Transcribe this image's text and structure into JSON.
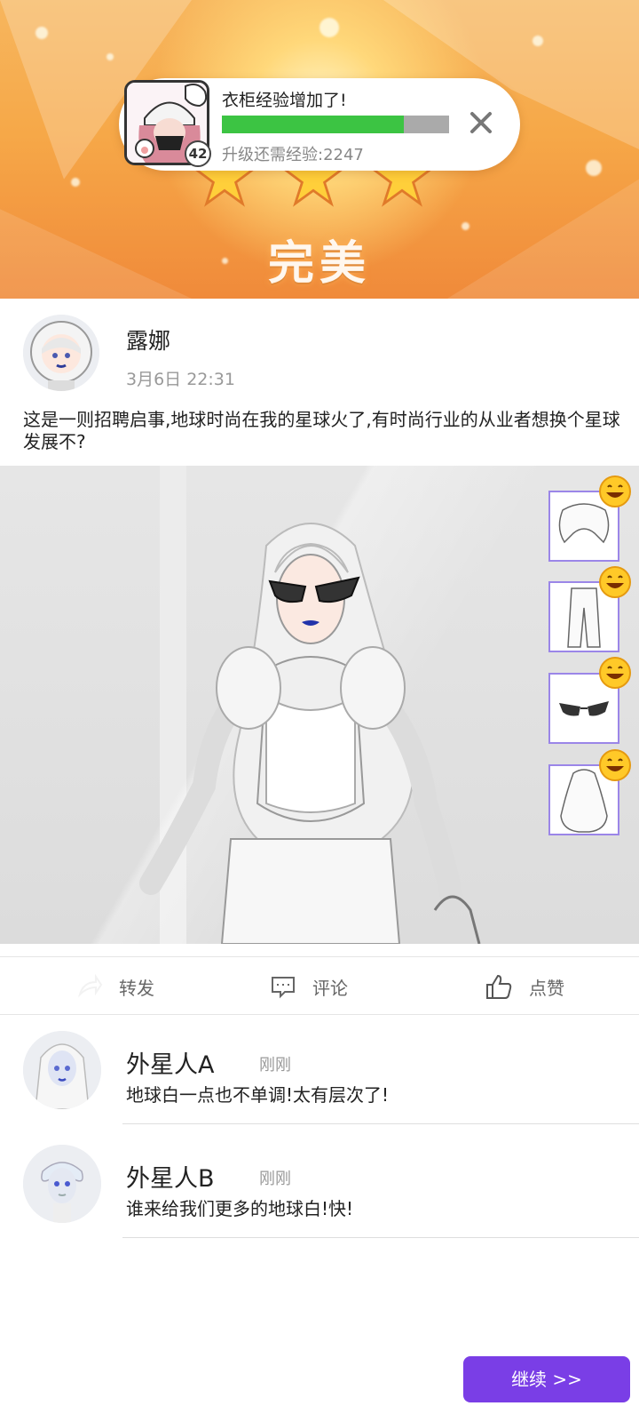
{
  "toast": {
    "title": "衣柜经验增加了!",
    "progress": 0.8,
    "need_label": "升级还需经验:2247",
    "level": "42",
    "bar_fill_color": "#3cc443",
    "bar_track_color": "#aaaaaa",
    "close_icon": "close-icon"
  },
  "result": {
    "stars": 3,
    "rating": "完美"
  },
  "post": {
    "author": "露娜",
    "time": "3月6日 22:31",
    "text": "这是一则招聘启事,地球时尚在我的星球火了,有时尚行业的从业者想换个星球发展不?"
  },
  "outfit_items": [
    {
      "icon": "cape-item-icon",
      "reaction": "smiley-icon"
    },
    {
      "icon": "pants-item-icon",
      "reaction": "smiley-icon"
    },
    {
      "icon": "sunglasses-item-icon",
      "reaction": "smiley-icon"
    },
    {
      "icon": "hair-item-icon",
      "reaction": "smiley-icon"
    }
  ],
  "actions": {
    "share": "转发",
    "comment": "评论",
    "like": "点赞"
  },
  "comments": [
    {
      "name": "外星人A",
      "time": "刚刚",
      "text": "地球白一点也不单调!太有层次了!"
    },
    {
      "name": "外星人B",
      "time": "刚刚",
      "text": "谁来给我们更多的地球白!快!"
    }
  ],
  "continue_label": "继续 >>",
  "colors": {
    "accent": "#7a3ee6",
    "tile_border": "#9b86e8",
    "banner": "#f6a848"
  }
}
